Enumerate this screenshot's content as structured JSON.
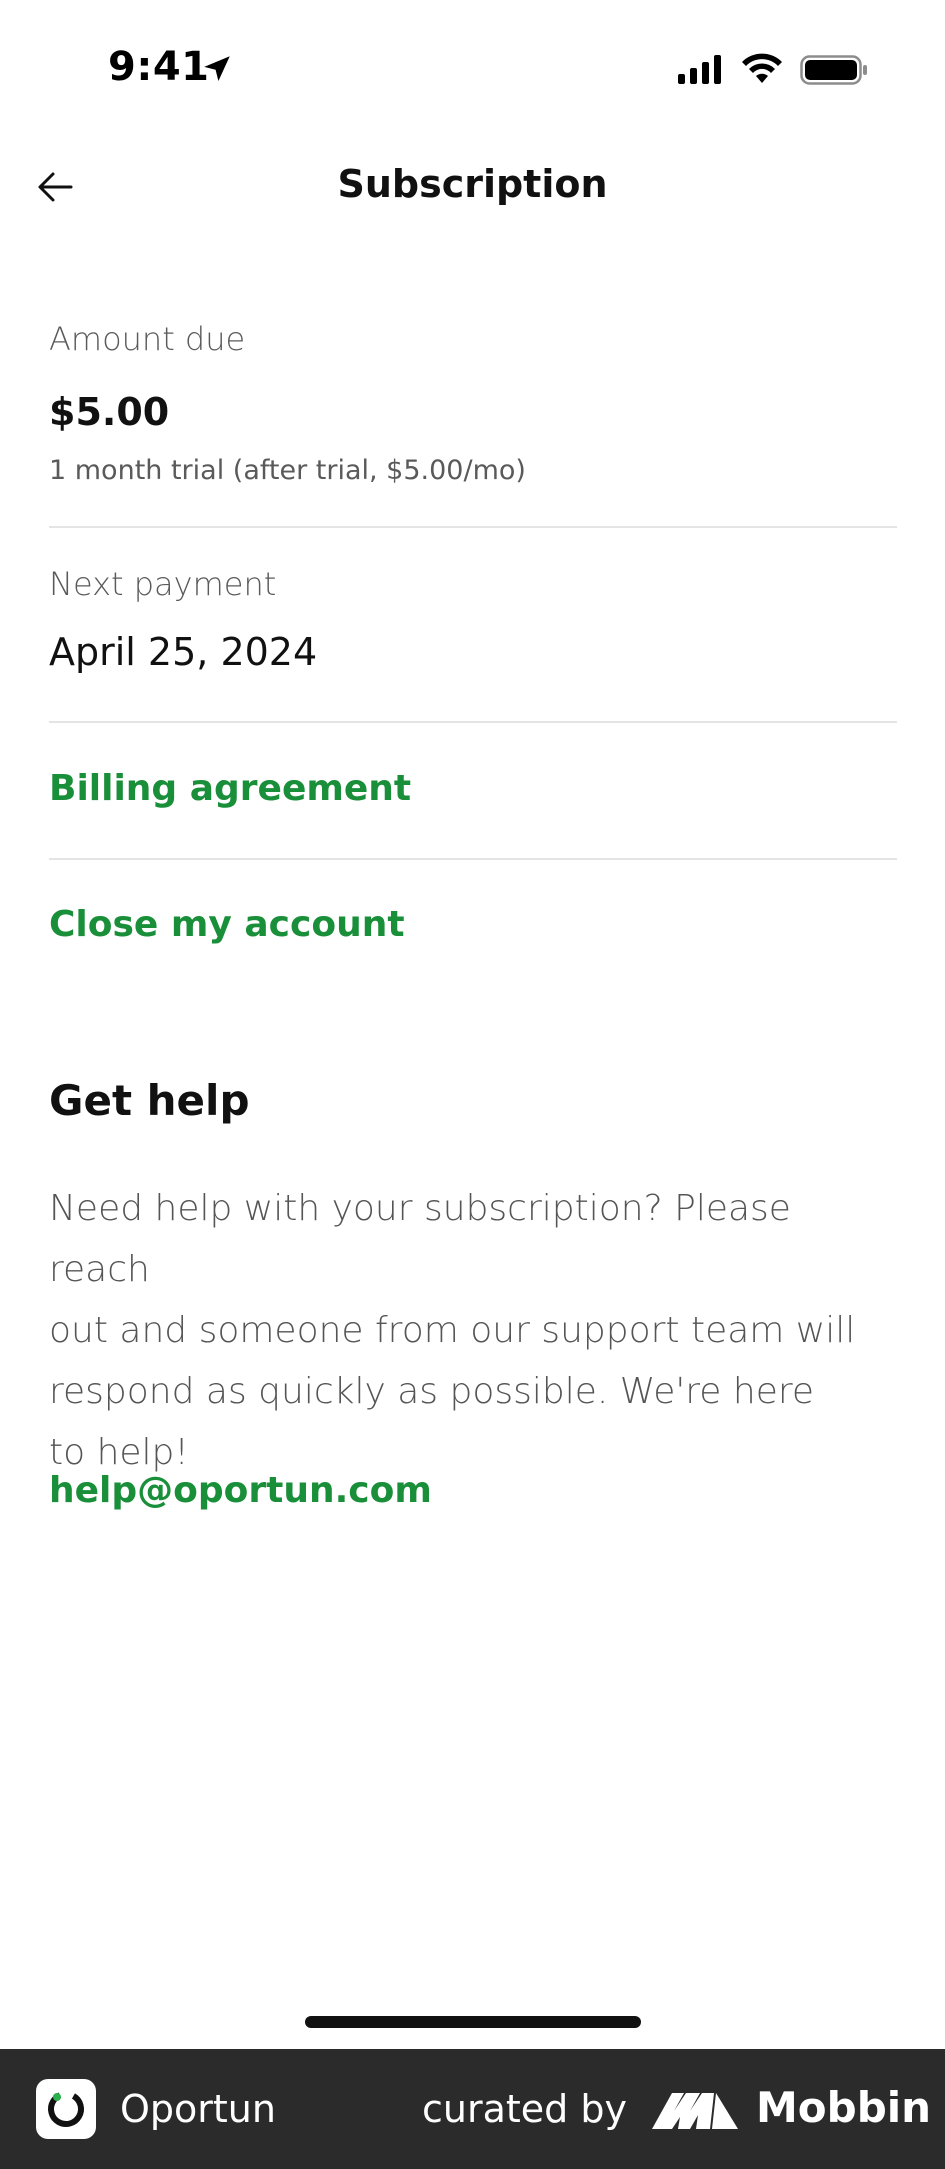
{
  "status_bar": {
    "time": "9:41",
    "icons": [
      "location-arrow-icon",
      "cellular-signal-icon",
      "wifi-icon",
      "battery-icon"
    ]
  },
  "header": {
    "title": "Subscription",
    "back_icon": "arrow-left-icon"
  },
  "subscription": {
    "amount_label": "Amount due",
    "amount_value": "$5.00",
    "trial_note": "1 month trial (after trial, $5.00/mo)",
    "next_payment_label": "Next payment",
    "next_payment_value": "April 25, 2024",
    "billing_link": "Billing agreement",
    "close_link": "Close my account"
  },
  "help": {
    "title": "Get help",
    "body_lines": [
      "Need help with your subscription? Please reach",
      "out and someone from our support team will",
      "respond as quickly as possible. We're here",
      "to help!"
    ],
    "email": "help@oportun.com"
  },
  "footer": {
    "app_name": "Oportun",
    "curated_by": "curated by",
    "brand": "Mobbin"
  },
  "colors": {
    "accent_green": "#1a8f3a",
    "footer_bg": "#2b2b2b",
    "divider": "#e4e4e4"
  }
}
